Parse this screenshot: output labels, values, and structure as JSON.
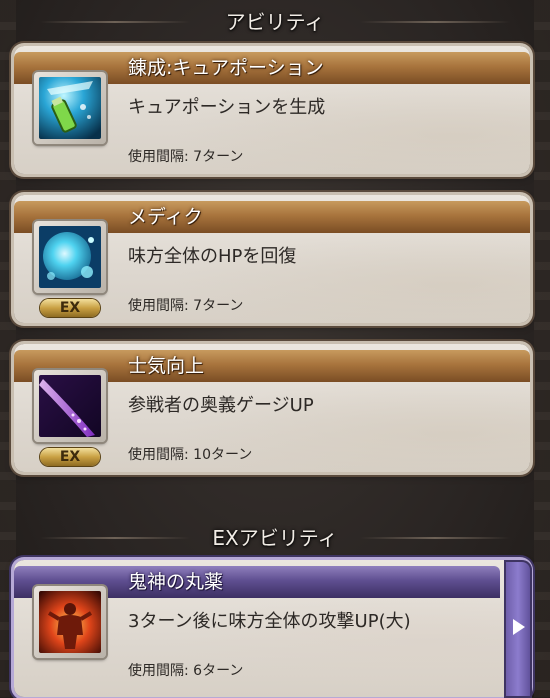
{
  "sections": {
    "abilities_header": "アビリティ",
    "ex_header": "EXアビリティ"
  },
  "abilities": [
    {
      "name": "錬成:キュアポーション",
      "description": "キュアポーションを生成",
      "cooldown": "使用間隔: 7ターン",
      "icon": "cure-potion-icon",
      "ex": false
    },
    {
      "name": "メディク",
      "description": "味方全体のHPを回復",
      "cooldown": "使用間隔: 7ターン",
      "icon": "medic-orb-icon",
      "ex": true,
      "ex_label": "EX"
    },
    {
      "name": "士気向上",
      "description": "参戦者の奥義ゲージUP",
      "cooldown": "使用間隔: 10ターン",
      "icon": "morale-beam-icon",
      "ex": true,
      "ex_label": "EX"
    }
  ],
  "ex_abilities": [
    {
      "name": "鬼神の丸薬",
      "description": "3ターン後に味方全体の攻撃UP(大)",
      "cooldown": "使用間隔: 6ターン",
      "icon": "demon-pill-icon"
    }
  ],
  "colors": {
    "ability_title_bar": "#a8743d",
    "ex_title_bar": "#5f4f91",
    "ex_badge": "#c9a043"
  }
}
